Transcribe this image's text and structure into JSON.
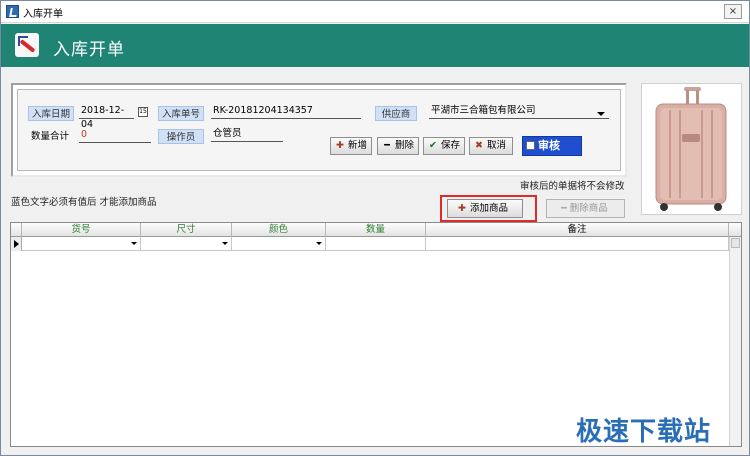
{
  "window": {
    "title": "入库开单",
    "close_label": "×"
  },
  "banner": {
    "title": "入库开单"
  },
  "form": {
    "date_label": "入库日期",
    "date_value": "2018-12-04",
    "order_no_label": "入库单号",
    "order_no_value": "RK-20181204134357",
    "supplier_label": "供应商",
    "supplier_value": "平湖市三合箱包有限公司",
    "qty_total_label": "数量合计",
    "qty_total_value": "0",
    "operator_label": "操作员",
    "operator_value": "仓管员",
    "calendar_icon": "15"
  },
  "actions": {
    "new_label": "新增",
    "delete_label": "删除",
    "save_label": "保存",
    "cancel_label": "取消",
    "audit_label": "审核"
  },
  "notes": {
    "audit_note": "审核后的单据将不会修改",
    "blue_note": "蓝色文字必须有值后 才能添加商品"
  },
  "item_buttons": {
    "add_label": "添加商品",
    "remove_label": "删除商品"
  },
  "grid": {
    "columns": [
      "货号",
      "尺寸",
      "颜色",
      "数量",
      "备注"
    ]
  },
  "watermark": "极速下载站",
  "colors": {
    "banner": "#1f8474",
    "audit": "#1f4ecf",
    "highlight": "#e12a2a",
    "required_label": "#cfe0f7"
  }
}
